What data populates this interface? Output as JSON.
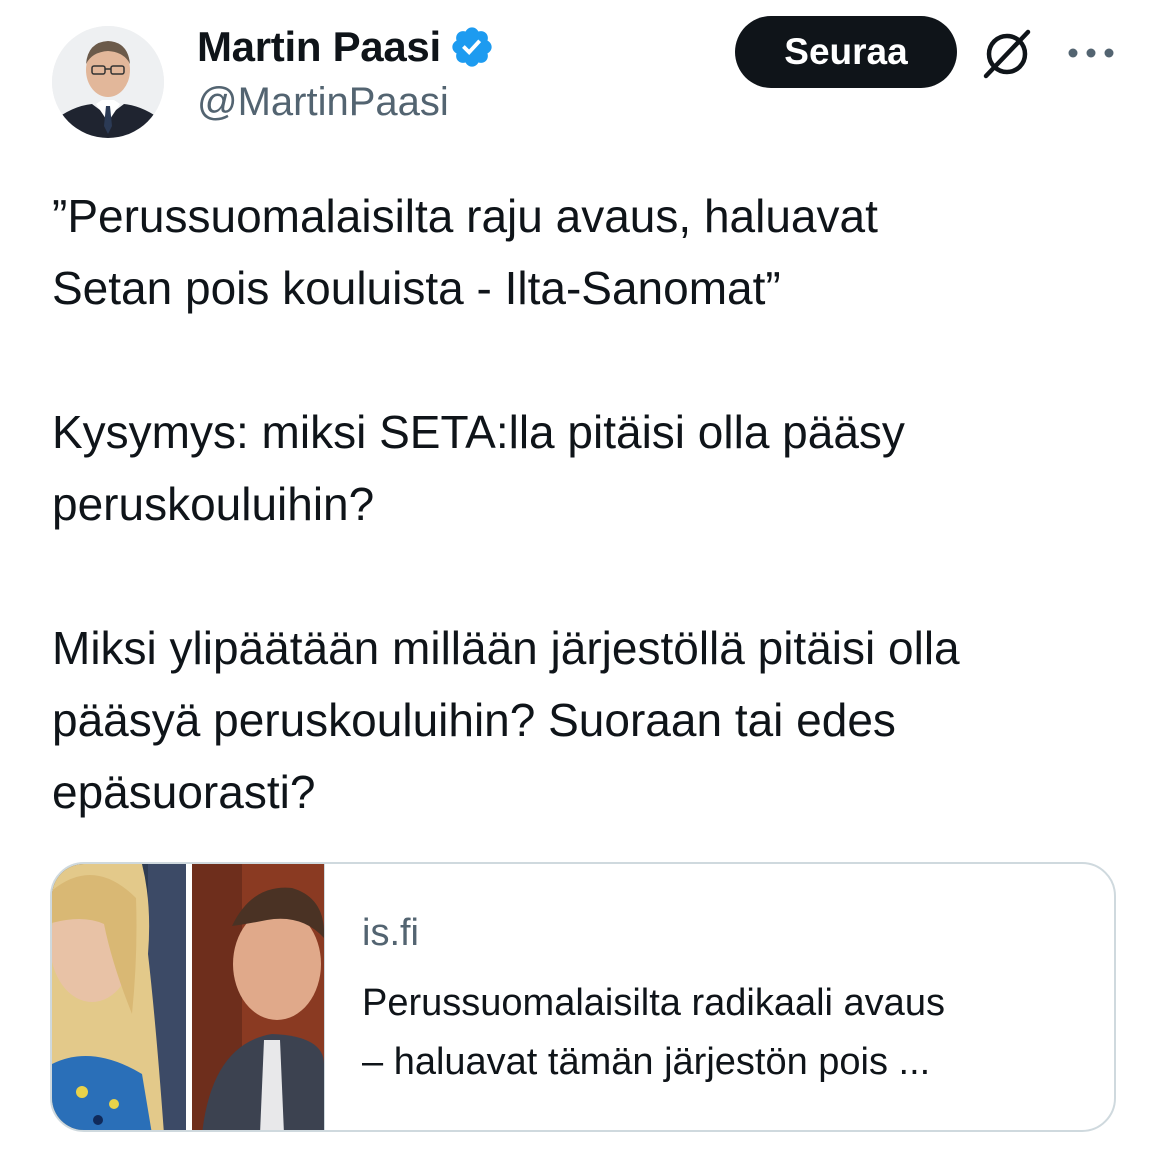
{
  "author": {
    "display_name": "Martin Paasi",
    "handle": "@MartinPaasi",
    "verified": true,
    "verified_color": "#1d9bf0"
  },
  "actions": {
    "follow_label": "Seuraa",
    "grok_icon": "grok-icon",
    "more_icon": "more-options-icon"
  },
  "tweet": {
    "paragraphs": [
      "”Perussuomalaisilta raju avaus, haluavat\nSetan pois kouluista - Ilta-Sanomat”",
      "Kysymys: miksi SETA:lla pitäisi olla pääsy\nperuskouluihin?",
      "Miksi ylipäätään millään järjestöllä pitäisi olla\npääsyä peruskouluihin? Suoraan tai edes\nepäsuorasti?"
    ]
  },
  "link_card": {
    "domain": "is.fi",
    "title": "Perussuomalaisilta radikaali avaus\n– haluavat tämän järjestön pois ..."
  },
  "colors": {
    "text_primary": "#0f1419",
    "text_secondary": "#536471",
    "button_bg": "#0f1419",
    "border": "#cfd9de"
  }
}
